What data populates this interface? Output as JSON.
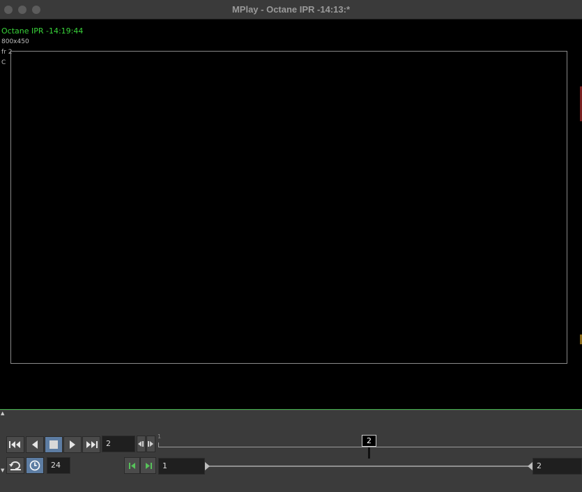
{
  "window": {
    "title": "MPlay - Octane IPR -14:13:*"
  },
  "viewport": {
    "overlay_title": "Octane IPR -14:19:44",
    "resolution": "800x450",
    "frame_label": "fr 2",
    "channel_label": "C"
  },
  "playback": {
    "current_frame": "2",
    "fps": "24",
    "range_start": "1",
    "range_end": "2",
    "timeline_start_label": "1",
    "cursor_label": "2"
  },
  "icons": {
    "go_to_start": "skip-to-start-icon",
    "step_back": "play-reverse-icon",
    "stop": "stop-icon",
    "play": "play-forward-icon",
    "go_to_end": "skip-to-end-icon",
    "step_prev": "step-prev-frame-icon",
    "step_next": "step-next-frame-icon",
    "loop": "loop-mode-icon",
    "realtime": "realtime-clock-icon",
    "set_start": "set-range-start-icon",
    "set_end": "set-range-end-icon"
  },
  "colors": {
    "overlay_title": "#39d43a",
    "active_button": "#5d7da3",
    "divider": "#3fae4a",
    "range_handle_green": "#57c25a"
  }
}
